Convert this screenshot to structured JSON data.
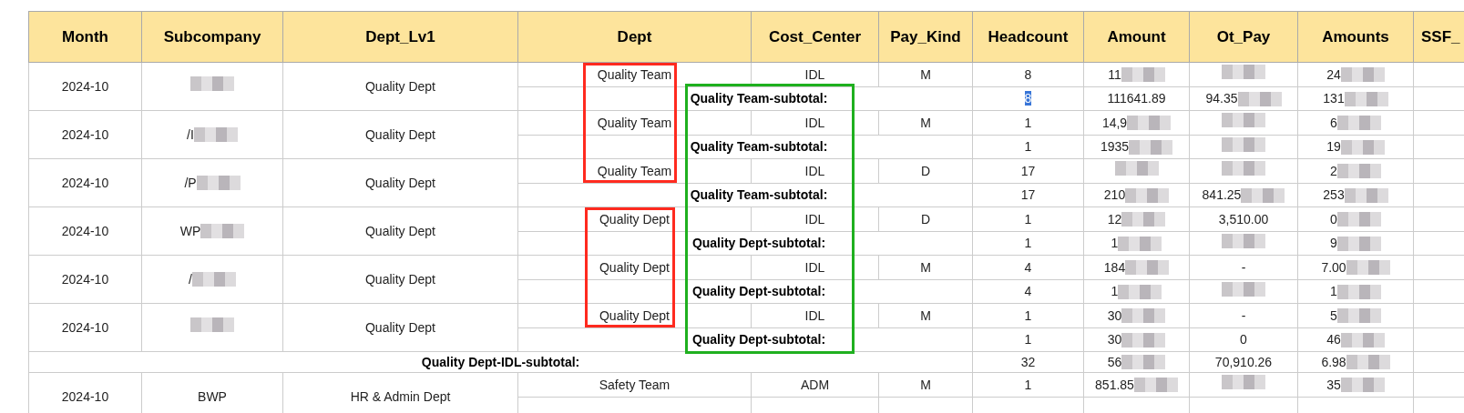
{
  "columns": [
    "Month",
    "Subcompany",
    "Dept_Lv1",
    "Dept",
    "Cost_Center",
    "Pay_Kind",
    "Headcount",
    "Amount",
    "Ot_Pay",
    "Amounts",
    "SSF_"
  ],
  "groups": [
    {
      "month": "2024-10",
      "subcompany": {
        "redacted": true
      },
      "dept_lv1": "Quality Dept",
      "dept": "Quality Team",
      "cost_center": "IDL",
      "pay_kind": "M",
      "headcount": "8",
      "amount": {
        "text": "11",
        "redacted": true
      },
      "ot_pay": {
        "redacted": true
      },
      "amounts": {
        "text": "24",
        "redacted": true
      },
      "subtotal": {
        "label": "Quality Team-subtotal:",
        "headcount": "8",
        "headcount_selected": true,
        "amount": {
          "text": "111641.89"
        },
        "ot_pay": {
          "text": "94.35",
          "redacted": true
        },
        "amounts": {
          "text": "131",
          "redacted": true
        }
      }
    },
    {
      "month": "2024-10",
      "subcompany": {
        "text": "/I",
        "redacted": true
      },
      "dept_lv1": "Quality Dept",
      "dept": "Quality Team",
      "cost_center": "IDL",
      "pay_kind": "M",
      "headcount": "1",
      "amount": {
        "text": "14,9",
        "redacted": true
      },
      "ot_pay": {
        "redacted": true
      },
      "amounts": {
        "text": "6",
        "redacted": true
      },
      "subtotal": {
        "label": "Quality Team-subtotal:",
        "headcount": "1",
        "headcount_selected": false,
        "amount": {
          "text": "1935",
          "redacted": true
        },
        "ot_pay": {
          "redacted": true
        },
        "amounts": {
          "text": "19",
          "redacted": true
        }
      }
    },
    {
      "month": "2024-10",
      "subcompany": {
        "text": "/P",
        "redacted": true
      },
      "dept_lv1": "Quality Dept",
      "dept": "Quality Team",
      "cost_center": "IDL",
      "pay_kind": "D",
      "headcount": "17",
      "amount": {
        "redacted": true
      },
      "ot_pay": {
        "redacted": true
      },
      "amounts": {
        "text": "2",
        "redacted": true
      },
      "subtotal": {
        "label": "Quality Team-subtotal:",
        "headcount": "17",
        "headcount_selected": false,
        "amount": {
          "text": "210",
          "redacted": true
        },
        "ot_pay": {
          "text": "841.25",
          "redacted": true
        },
        "amounts": {
          "text": "253",
          "redacted": true
        }
      }
    },
    {
      "month": "2024-10",
      "subcompany": {
        "text": "WP",
        "redacted": true
      },
      "dept_lv1": "Quality Dept",
      "dept": "Quality Dept",
      "cost_center": "IDL",
      "pay_kind": "D",
      "headcount": "1",
      "amount": {
        "text": "12",
        "redacted": true
      },
      "ot_pay": {
        "text": "3,510.00"
      },
      "amounts": {
        "text": "0",
        "redacted": true
      },
      "subtotal": {
        "label": "Quality Dept-subtotal:",
        "headcount": "1",
        "headcount_selected": false,
        "amount": {
          "text": "1",
          "redacted": true
        },
        "ot_pay": {
          "redacted": true
        },
        "amounts": {
          "text": "9",
          "redacted": true
        }
      }
    },
    {
      "month": "2024-10",
      "subcompany": {
        "text": "/",
        "redacted": true
      },
      "dept_lv1": "Quality Dept",
      "dept": "Quality Dept",
      "cost_center": "IDL",
      "pay_kind": "M",
      "headcount": "4",
      "amount": {
        "text": "184",
        "redacted": true
      },
      "ot_pay": {
        "text": "-"
      },
      "amounts": {
        "text": "7.00",
        "redacted": true
      },
      "subtotal": {
        "label": "Quality Dept-subtotal:",
        "headcount": "4",
        "headcount_selected": false,
        "amount": {
          "text": "1",
          "redacted": true
        },
        "ot_pay": {
          "redacted": true
        },
        "amounts": {
          "text": "1",
          "redacted": true
        }
      }
    },
    {
      "month": "2024-10",
      "subcompany": {
        "redacted": true
      },
      "dept_lv1": "Quality Dept",
      "dept": "Quality Dept",
      "cost_center": "IDL",
      "pay_kind": "M",
      "headcount": "1",
      "amount": {
        "text": "30",
        "redacted": true
      },
      "ot_pay": {
        "text": "-"
      },
      "amounts": {
        "text": "5",
        "redacted": true
      },
      "subtotal": {
        "label": "Quality Dept-subtotal:",
        "headcount": "1",
        "headcount_selected": false,
        "amount": {
          "text": "30",
          "redacted": true
        },
        "ot_pay": {
          "text": "0"
        },
        "amounts": {
          "text": "46",
          "redacted": true
        }
      }
    }
  ],
  "total": {
    "label": "Quality Dept-IDL-subtotal:",
    "headcount": "32",
    "amount": {
      "text": "56",
      "redacted": true
    },
    "ot_pay": {
      "text": "70,910.26"
    },
    "amounts": {
      "text": "6.98",
      "redacted": true
    }
  },
  "last_group": {
    "month": "2024-10",
    "subcompany": {
      "text": "BWP"
    },
    "dept_lv1": "HR & Admin Dept",
    "dept": "Safety Team",
    "cost_center": "ADM",
    "pay_kind": "M",
    "headcount": "1",
    "amount": {
      "text": "851.85",
      "redacted": true
    },
    "ot_pay": {
      "redacted": true
    },
    "amounts": {
      "text": "35",
      "redacted": true
    }
  },
  "annotations": [
    {
      "kind": "dept_box",
      "color": "#ff2a1f"
    },
    {
      "kind": "dept_box",
      "color": "#ff2a1f"
    },
    {
      "kind": "subtotal_box",
      "color": "#1fb01f"
    }
  ]
}
